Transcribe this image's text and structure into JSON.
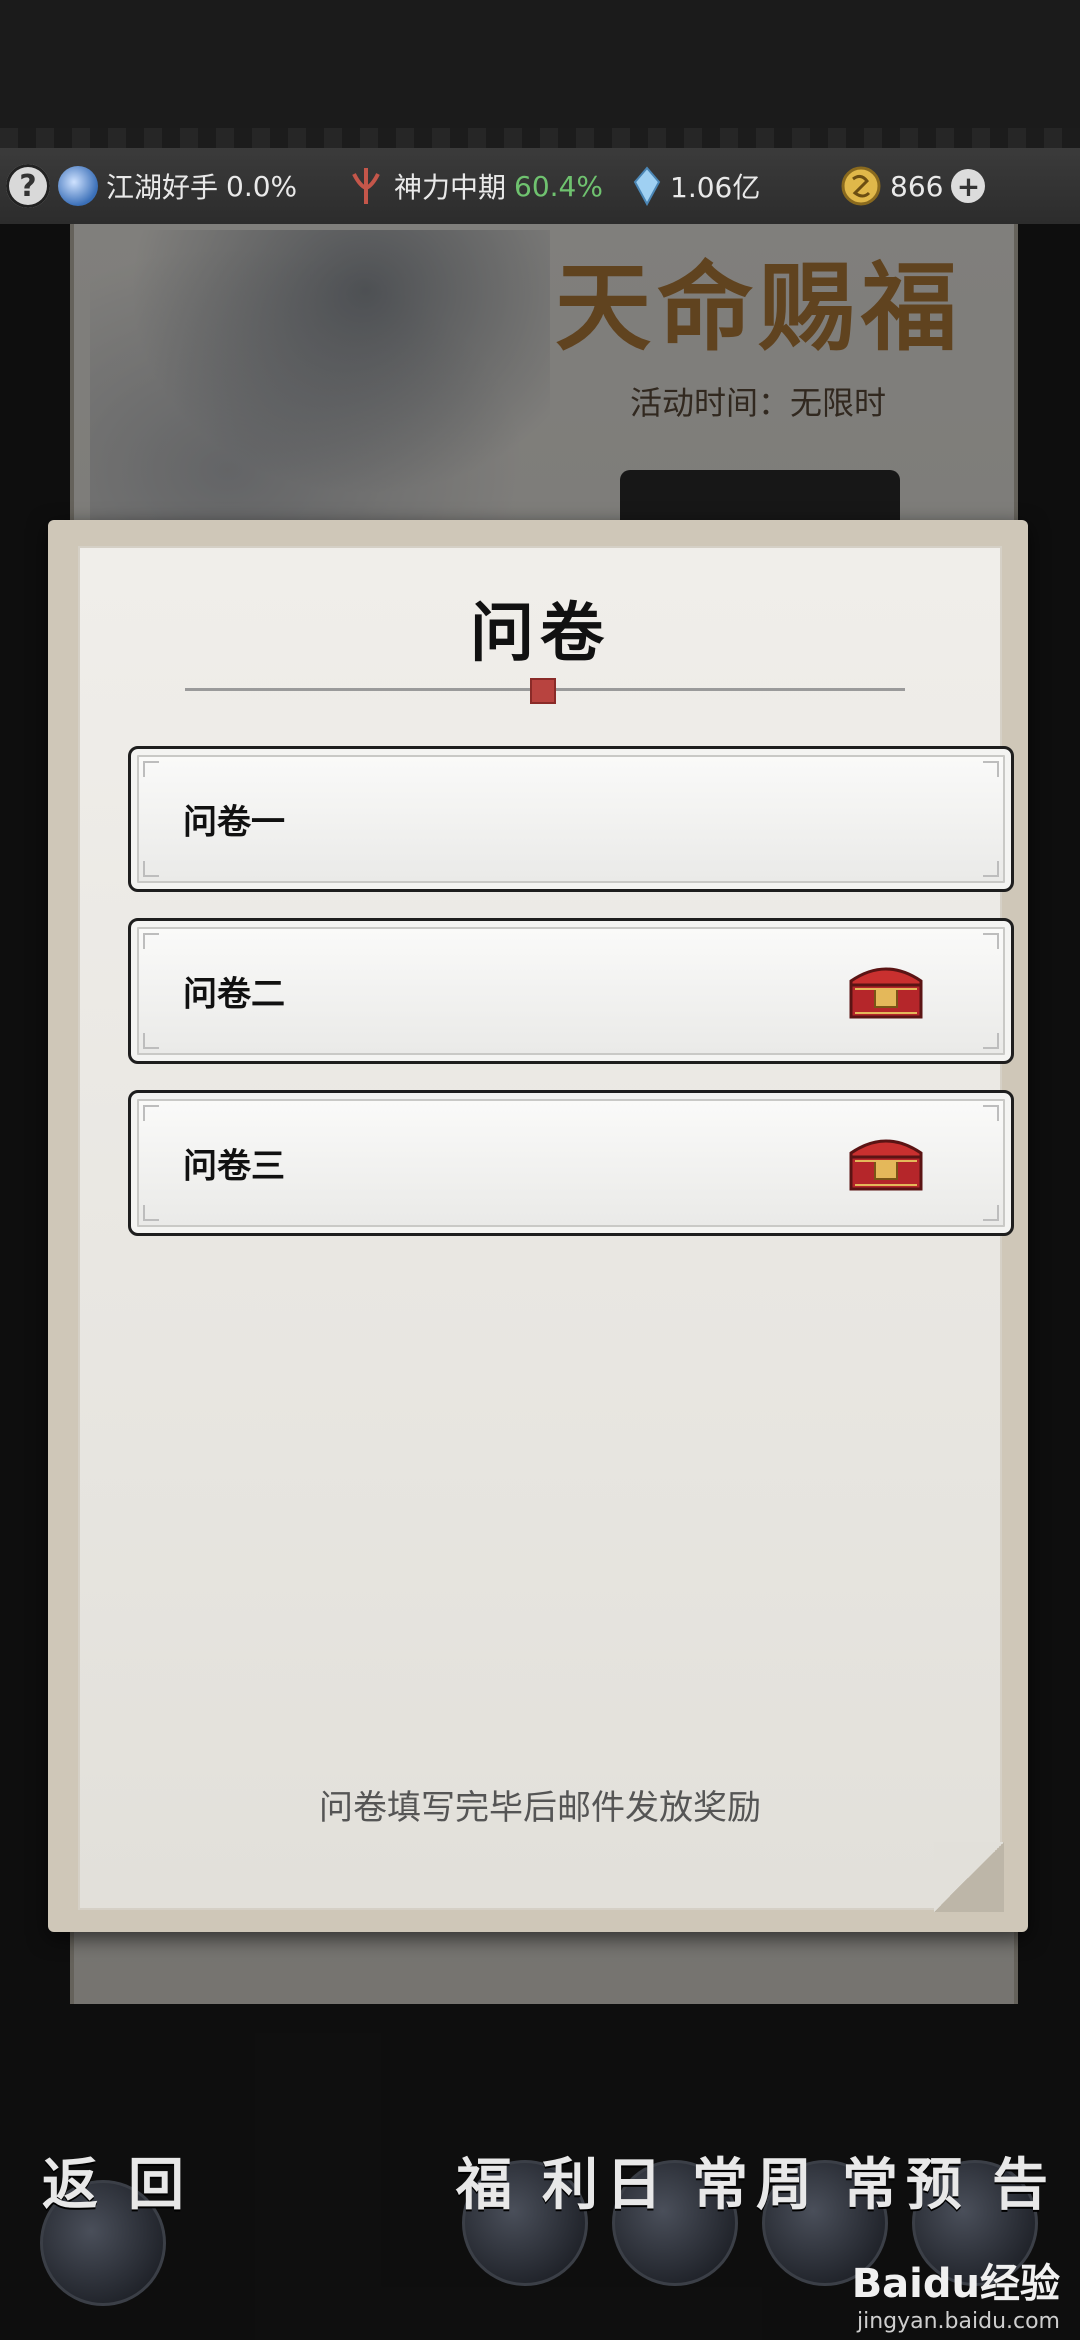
{
  "status_bar": {
    "help_symbol": "?",
    "rank_name": "江湖好手",
    "rank_percent": "0.0%",
    "power_name": "神力中期",
    "power_percent": "60.4%",
    "crystal_amount": "1.06亿",
    "coin_amount": "866",
    "add_symbol": "+"
  },
  "background_event": {
    "title": "天命赐福",
    "time_label": "活动时间：无限时"
  },
  "dialog": {
    "title": "问卷",
    "items": [
      {
        "label": "问卷一",
        "has_reward_chest": false
      },
      {
        "label": "问卷二",
        "has_reward_chest": true
      },
      {
        "label": "问卷三",
        "has_reward_chest": true
      }
    ],
    "footer_note": "问卷填写完毕后邮件发放奖励"
  },
  "bottom_nav": {
    "back": "返回",
    "welfare": "福利",
    "daily": "日常",
    "weekly": "周常",
    "preview": "预告"
  },
  "watermark": {
    "brand": "Baidu经验",
    "url": "jingyan.baidu.com"
  },
  "colors": {
    "accent_green": "#6fc26f",
    "chest_red": "#b5262a",
    "event_title_gold": "#b07a3a"
  }
}
